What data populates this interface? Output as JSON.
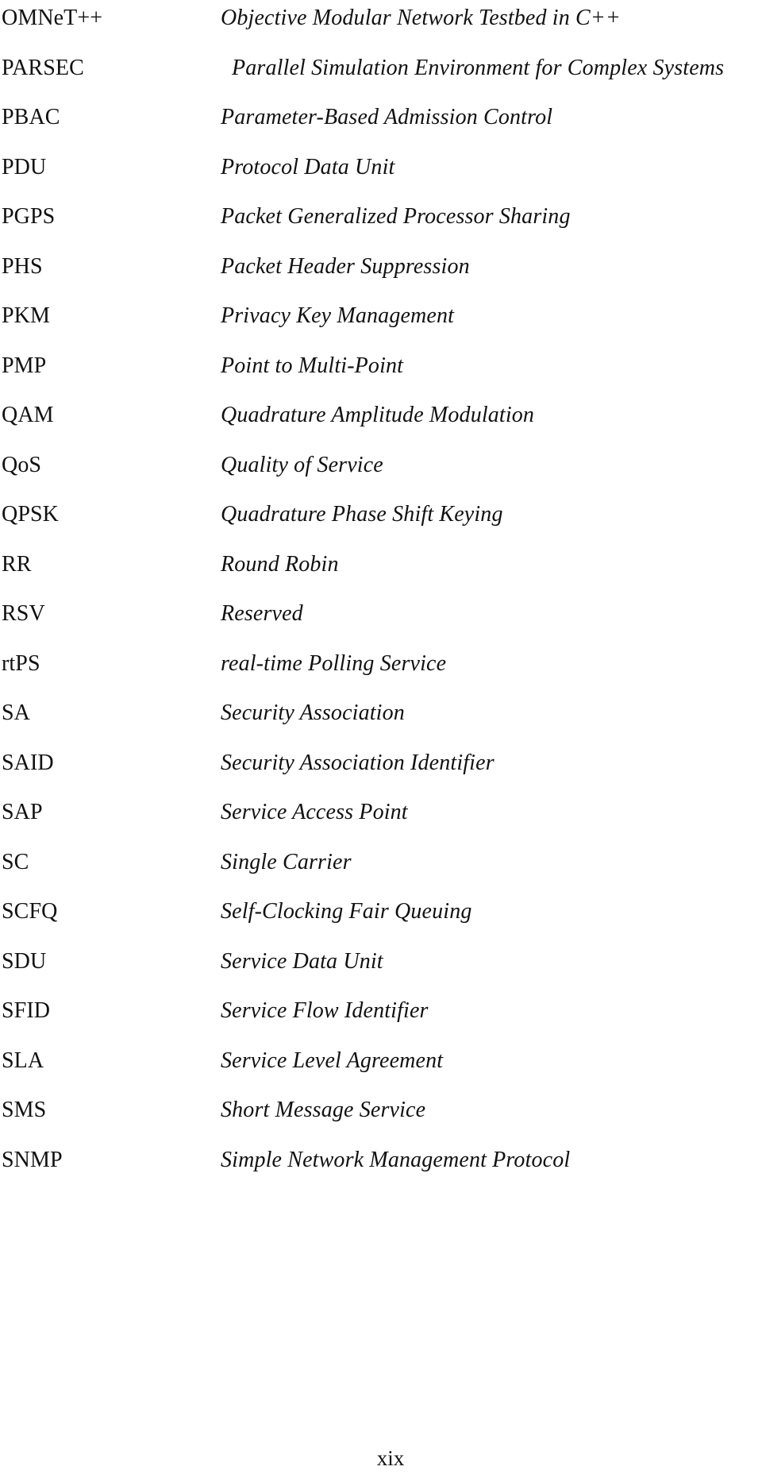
{
  "document": {
    "kind": "abbreviations-glossary",
    "page_number": "xix",
    "columns": {
      "term_header": "",
      "definition_header": ""
    }
  },
  "entries": [
    {
      "term": "OMNeT++",
      "definition": "Objective Modular Network Testbed in C++",
      "indented": false
    },
    {
      "term": "PARSEC",
      "definition": "Parallel Simulation Environment for Complex Systems",
      "indented": true
    },
    {
      "term": "PBAC",
      "definition": "Parameter-Based Admission Control",
      "indented": false
    },
    {
      "term": "PDU",
      "definition": "Protocol Data Unit",
      "indented": false
    },
    {
      "term": "PGPS",
      "definition": "Packet Generalized Processor Sharing",
      "indented": false
    },
    {
      "term": "PHS",
      "definition": "Packet Header Suppression",
      "indented": false
    },
    {
      "term": "PKM",
      "definition": "Privacy Key Management",
      "indented": false
    },
    {
      "term": "PMP",
      "definition": "Point to Multi-Point",
      "indented": false
    },
    {
      "term": "QAM",
      "definition": "Quadrature Amplitude Modulation",
      "indented": false
    },
    {
      "term": "QoS",
      "definition": "Quality of Service",
      "indented": false
    },
    {
      "term": "QPSK",
      "definition": "Quadrature Phase Shift Keying",
      "indented": false
    },
    {
      "term": "RR",
      "definition": "Round Robin",
      "indented": false
    },
    {
      "term": "RSV",
      "definition": "Reserved",
      "indented": false
    },
    {
      "term": "rtPS",
      "definition": "real-time Polling Service",
      "indented": false
    },
    {
      "term": "SA",
      "definition": "Security Association",
      "indented": false
    },
    {
      "term": "SAID",
      "definition": "Security Association Identifier",
      "indented": false
    },
    {
      "term": "SAP",
      "definition": "Service Access Point",
      "indented": false
    },
    {
      "term": "SC",
      "definition": "Single Carrier",
      "indented": false
    },
    {
      "term": "SCFQ",
      "definition": "Self-Clocking Fair Queuing",
      "indented": false
    },
    {
      "term": "SDU",
      "definition": "Service Data Unit",
      "indented": false
    },
    {
      "term": "SFID",
      "definition": "Service Flow Identifier",
      "indented": false
    },
    {
      "term": "SLA",
      "definition": "Service Level Agreement",
      "indented": false
    },
    {
      "term": "SMS",
      "definition": "Short Message Service",
      "indented": false
    },
    {
      "term": "SNMP",
      "definition": "Simple Network Management Protocol",
      "indented": false
    }
  ],
  "colors": {
    "page_background": "#ffffff",
    "text": "#111111"
  }
}
